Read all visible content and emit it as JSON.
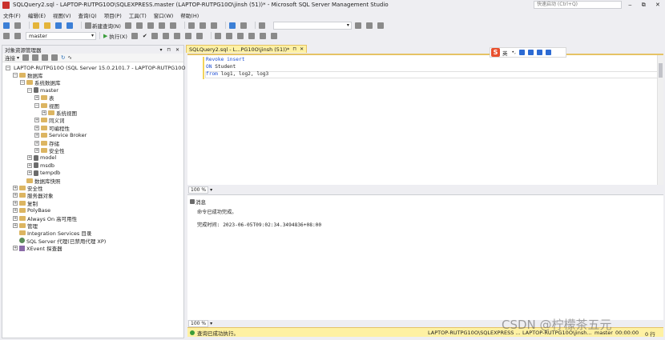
{
  "window": {
    "title": "SQLQuery2.sql - LAPTOP-RUTPG10O\\SQLEXPRESS.master (LAPTOP-RUTPG10O\\jinsh (51))* - Microsoft SQL Server Management Studio",
    "quick_launch_placeholder": "快速启动 (Ctrl+Q)",
    "controls": [
      "‒",
      "⧉",
      "✕"
    ]
  },
  "menu": [
    "文件(F)",
    "编辑(E)",
    "视图(V)",
    "查询(Q)",
    "项目(P)",
    "工具(T)",
    "窗口(W)",
    "帮助(H)"
  ],
  "toolbar1": {
    "new_query": "新建查询(N)"
  },
  "toolbar2": {
    "database": "master",
    "execute": "执行(X)"
  },
  "object_explorer": {
    "title": "对象资源管理器",
    "header_controls": "▾ ⊓ ✕",
    "connect": "连接",
    "tree": [
      {
        "label": "LAPTOP-RUTPG10O (SQL Server 15.0.2101.7 - LAPTOP-RUTPG10O",
        "icon": "server-icon",
        "exp": "−",
        "indent": 0
      },
      {
        "label": "数据库",
        "icon": "folder-icon",
        "exp": "−",
        "indent": 1
      },
      {
        "label": "系统数据库",
        "icon": "folder-icon",
        "exp": "−",
        "indent": 2
      },
      {
        "label": "master",
        "icon": "database-icon",
        "exp": "−",
        "indent": 3
      },
      {
        "label": "表",
        "icon": "folder-icon",
        "exp": "+",
        "indent": 4
      },
      {
        "label": "视图",
        "icon": "folder-icon",
        "exp": "−",
        "indent": 4
      },
      {
        "label": "系统视图",
        "icon": "folder-icon",
        "exp": "+",
        "indent": 5
      },
      {
        "label": "同义词",
        "icon": "folder-icon",
        "exp": "+",
        "indent": 4
      },
      {
        "label": "可编程性",
        "icon": "folder-icon",
        "exp": "+",
        "indent": 4
      },
      {
        "label": "Service Broker",
        "icon": "folder-icon",
        "exp": "+",
        "indent": 4
      },
      {
        "label": "存储",
        "icon": "folder-icon",
        "exp": "+",
        "indent": 4
      },
      {
        "label": "安全性",
        "icon": "folder-icon",
        "exp": "+",
        "indent": 4
      },
      {
        "label": "model",
        "icon": "database-icon",
        "exp": "+",
        "indent": 3
      },
      {
        "label": "msdb",
        "icon": "database-icon",
        "exp": "+",
        "indent": 3
      },
      {
        "label": "tempdb",
        "icon": "database-icon",
        "exp": "+",
        "indent": 3
      },
      {
        "label": "数据库快照",
        "icon": "folder-icon",
        "exp": "",
        "indent": 2
      },
      {
        "label": "安全性",
        "icon": "folder-icon",
        "exp": "+",
        "indent": 1
      },
      {
        "label": "服务器对象",
        "icon": "folder-icon",
        "exp": "+",
        "indent": 1
      },
      {
        "label": "复制",
        "icon": "folder-icon",
        "exp": "+",
        "indent": 1
      },
      {
        "label": "PolyBase",
        "icon": "folder-icon",
        "exp": "+",
        "indent": 1
      },
      {
        "label": "Always On 高可用性",
        "icon": "folder-icon",
        "exp": "+",
        "indent": 1
      },
      {
        "label": "管理",
        "icon": "folder-icon",
        "exp": "+",
        "indent": 1
      },
      {
        "label": "Integration Services 目录",
        "icon": "folder-icon",
        "exp": "",
        "indent": 1
      },
      {
        "label": "SQL Server 代理(已禁用代理 XP)",
        "icon": "agent-icon",
        "exp": "",
        "indent": 1
      },
      {
        "label": "XEvent 探查器",
        "icon": "xevent-icon",
        "exp": "+",
        "indent": 1
      }
    ]
  },
  "editor": {
    "tab_label": "SQLQuery2.sql - L...PG10O\\jinsh (51))*",
    "tab_close": "✕",
    "tab_pin": "⊓",
    "lines": [
      [
        {
          "t": "Revoke insert",
          "kw": true
        }
      ],
      [
        {
          "t": "ON ",
          "kw": true
        },
        {
          "t": "Student",
          "kw": false
        }
      ],
      [
        {
          "t": "from ",
          "kw": true
        },
        {
          "t": "log1, log2, log3",
          "kw": false
        }
      ]
    ],
    "zoom": "100 %"
  },
  "ime": {
    "logo": "S",
    "mode": "英"
  },
  "results": {
    "tab_label": "消息",
    "message": "命令已成功完成。",
    "completion": "完成时间: 2023-06-05T09:02:34.3494836+08:00",
    "zoom": "100 %"
  },
  "status": {
    "message": "查询已成功执行。",
    "server": "LAPTOP-RUTPG10O\\SQLEXPRESS ...",
    "user": "LAPTOP-RUTPG10O\\jinsh...",
    "db": "master",
    "time": "00:00:00",
    "rows": "0 行"
  },
  "watermark": "CSDN @柠檬茶五元"
}
